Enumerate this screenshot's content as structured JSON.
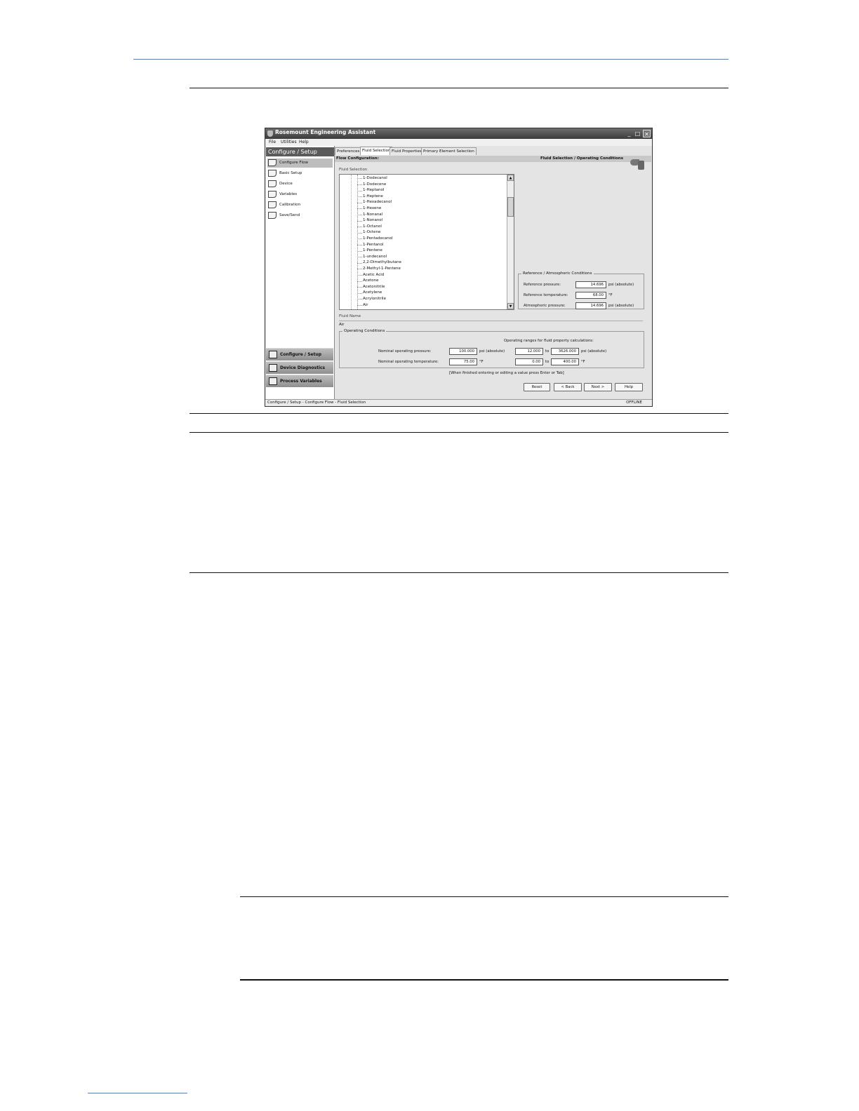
{
  "window": {
    "title": "Rosemount Engineering Assistant",
    "buttons": {
      "minimize": "_",
      "maximize": "□",
      "close": "✕"
    }
  },
  "menu": [
    "File",
    "Utilities",
    "Help"
  ],
  "left_pane": {
    "header": "Configure / Setup",
    "items": [
      {
        "label": "Configure Flow",
        "selected": true
      },
      {
        "label": "Basic Setup"
      },
      {
        "label": "Device"
      },
      {
        "label": "Variables"
      },
      {
        "label": "Calibration"
      },
      {
        "label": "Save/Send"
      }
    ],
    "nav_buttons": [
      "Configure / Setup",
      "Device Diagnostics",
      "Process Variables"
    ]
  },
  "tabs": [
    {
      "label": "Preferences"
    },
    {
      "label": "Fluid Selection",
      "active": true
    },
    {
      "label": "Fluid Properties"
    },
    {
      "label": "Primary Element Selection"
    }
  ],
  "flow_bar": {
    "left": "Flow Configuration:",
    "right": "Fluid Selection / Operating Conditions"
  },
  "fluid_selection": {
    "label": "Fluid Selection",
    "items": [
      "1-Dodecanol",
      "1-Dodecene",
      "1-Heptanol",
      "1-Heptene",
      "1-Hexadecanol",
      "1-Hexene",
      "1-Nonanal",
      "1-Nonanol",
      "1-Octanol",
      "1-Octene",
      "1-Pentadecanol",
      "1-Pentanol",
      "1-Pentene",
      "1-undecanol",
      "2,2-Dimethylbutane",
      "2-Methyl-1-Pentene",
      "Acetic Acid",
      "Acetone",
      "Acetonitrile",
      "Acetylene",
      "Acrylonitrile",
      "Air"
    ]
  },
  "reference": {
    "title": "Reference / Atmospheric Conditions",
    "rows": [
      {
        "label": "Reference pressure:",
        "value": "14.696",
        "unit": "psi (absolute)"
      },
      {
        "label": "Reference temperature:",
        "value": "68.00",
        "unit": "°F"
      },
      {
        "label": "Atmospheric pressure:",
        "value": "14.696",
        "unit": "psi (absolute)"
      }
    ]
  },
  "fluid_name": {
    "label": "Fluid Name",
    "value": "Air"
  },
  "operating": {
    "title": "Operating Conditions",
    "ranges_label": "Operating ranges for fluid property calculations:",
    "rows": [
      {
        "label": "Nominal operating pressure:",
        "value": "100.000",
        "unit": "psi (absolute)",
        "min": "12.000",
        "to": "to",
        "max": "3626.000",
        "range_unit": "psi (absolute)"
      },
      {
        "label": "Nominal operating temperature:",
        "value": "75.00",
        "unit": "°F",
        "min": "0.00",
        "to": "to",
        "max": "400.00",
        "range_unit": "°F"
      }
    ],
    "note": "[When finished entering or editing a value press Enter or Tab]"
  },
  "buttons": {
    "reset": "Reset",
    "back": "< Back",
    "next": "Next >",
    "help": "Help"
  },
  "status": {
    "left": "Configure / Setup - Configure Flow - Fluid Selection",
    "right": "OFFLINE"
  }
}
